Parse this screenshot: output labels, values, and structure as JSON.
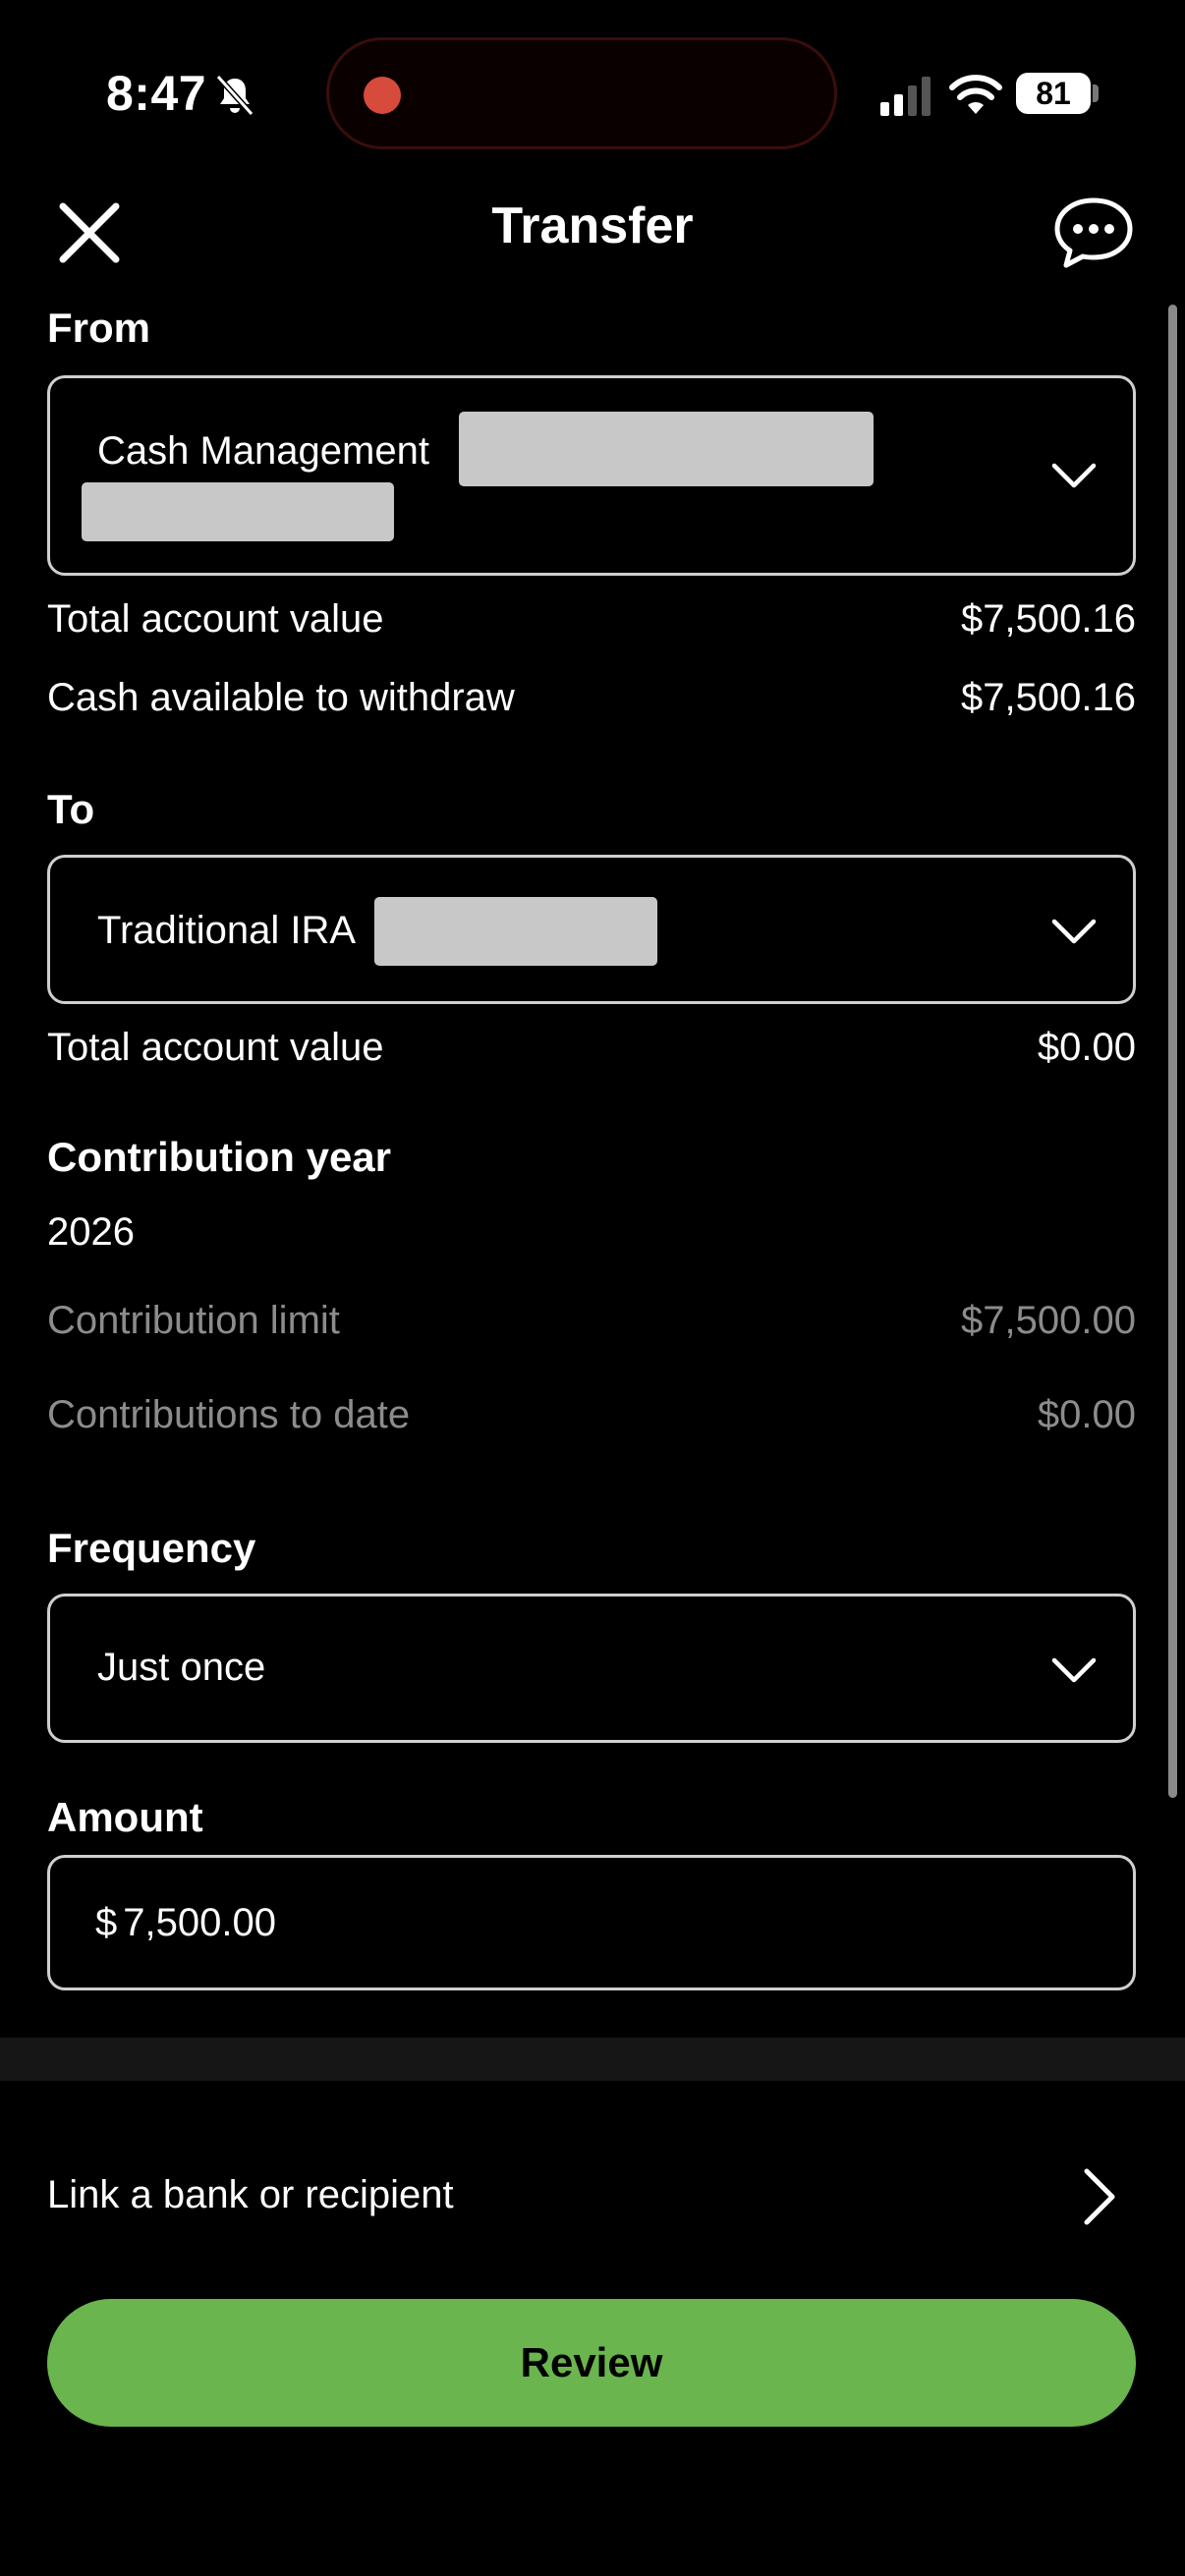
{
  "status_bar": {
    "time": "8:47",
    "battery": "81",
    "icons": [
      "bell-slash-icon",
      "signal-icon",
      "wifi-icon",
      "battery-icon"
    ]
  },
  "header": {
    "title": "Transfer",
    "close_icon": "close-icon",
    "chat_icon": "chat-bubble-icon"
  },
  "from": {
    "label": "From",
    "account_name": "Cash Management",
    "total_value_label": "Total account value",
    "total_value": "$7,500.16",
    "cash_available_label": "Cash available to withdraw",
    "cash_available": "$7,500.16"
  },
  "to": {
    "label": "To",
    "account_name": "Traditional IRA",
    "total_value_label": "Total account value",
    "total_value": "$0.00"
  },
  "contribution": {
    "label": "Contribution year",
    "year": "2026",
    "limit_label": "Contribution limit",
    "limit": "$7,500.00",
    "to_date_label": "Contributions to date",
    "to_date": "$0.00"
  },
  "frequency": {
    "label": "Frequency",
    "selected": "Just once"
  },
  "amount": {
    "label": "Amount",
    "currency": "$",
    "value": "7,500.00"
  },
  "link_bank": {
    "label": "Link a bank or recipient"
  },
  "review_button": {
    "label": "Review"
  },
  "colors": {
    "background": "#000000",
    "accent_green": "#6ab54e",
    "muted_text": "#8c8c8c",
    "redaction": "#c8c8c8"
  }
}
